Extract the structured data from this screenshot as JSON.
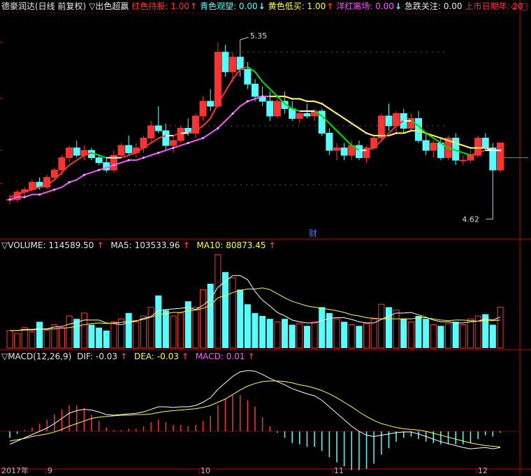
{
  "top_header": {
    "title": "德豪润达(日线 前复权)",
    "indicator": "▽出色超赢",
    "items": [
      {
        "label": "红色持股:",
        "value": "1.00",
        "arrow": "↑",
        "color": "red"
      },
      {
        "label": "青色观望:",
        "value": "0.00",
        "arrow": "↓",
        "color": "cyan"
      },
      {
        "label": "黄色低买:",
        "value": "1.00",
        "arrow": "↑",
        "color": "yellow"
      },
      {
        "label": "洋红离场:",
        "value": "0.00",
        "arrow": "↓",
        "color": "mag"
      },
      {
        "label": "急跌关注:",
        "value": "0.00",
        "arrow": "",
        "color": "white"
      },
      {
        "label": "上市日期年:",
        "value": "20",
        "arrow": "",
        "color": "red"
      }
    ],
    "corner_icons": [
      "diamond-icon",
      "window-icon"
    ]
  },
  "volume_header": {
    "label": "▽VOLUME:",
    "value": "114589.50",
    "ma5_label": "MA5:",
    "ma5_value": "103533.96",
    "ma10_label": "MA10:",
    "ma10_value": "80873.45"
  },
  "macd_header": {
    "label": "▽MACD(12,26,9)",
    "dif_label": "DIF:",
    "dif_value": "-0.03",
    "dea_label": "DEA:",
    "dea_value": "-0.03",
    "macd_label": "MACD:",
    "macd_value": "0.01"
  },
  "price_annotations": {
    "high": "5.35",
    "low": "4.62",
    "marker": "财"
  },
  "time_axis": [
    "2017年",
    "9",
    "10",
    "11",
    "12"
  ],
  "colors": {
    "up": "#ff3232",
    "down": "#54ffff",
    "yellow": "#ffff3c",
    "magenta": "#ff54ff",
    "green": "#00e000",
    "white": "#ffffff",
    "grid": "#c00000"
  },
  "chart_data": {
    "type": "candlestick",
    "price_range": [
      4.55,
      5.45
    ],
    "candles": [
      [
        4.7,
        4.72,
        4.68,
        4.7
      ],
      [
        4.7,
        4.74,
        4.69,
        4.73
      ],
      [
        4.73,
        4.75,
        4.71,
        4.74
      ],
      [
        4.74,
        4.78,
        4.73,
        4.77
      ],
      [
        4.77,
        4.79,
        4.74,
        4.75
      ],
      [
        4.75,
        4.8,
        4.74,
        4.79
      ],
      [
        4.79,
        4.83,
        4.78,
        4.82
      ],
      [
        4.82,
        4.88,
        4.8,
        4.87
      ],
      [
        4.87,
        4.92,
        4.85,
        4.91
      ],
      [
        4.91,
        4.94,
        4.87,
        4.88
      ],
      [
        4.88,
        4.92,
        4.86,
        4.9
      ],
      [
        4.9,
        4.91,
        4.86,
        4.87
      ],
      [
        4.87,
        4.88,
        4.84,
        4.85
      ],
      [
        4.85,
        4.87,
        4.81,
        4.82
      ],
      [
        4.82,
        4.9,
        4.81,
        4.88
      ],
      [
        4.88,
        4.93,
        4.87,
        4.92
      ],
      [
        4.92,
        4.96,
        4.88,
        4.89
      ],
      [
        4.89,
        4.93,
        4.87,
        4.91
      ],
      [
        4.91,
        4.96,
        4.89,
        4.95
      ],
      [
        4.95,
        5.02,
        4.93,
        5.0
      ],
      [
        5.0,
        5.08,
        4.97,
        4.98
      ],
      [
        4.98,
        5.01,
        4.9,
        4.92
      ],
      [
        4.92,
        4.96,
        4.89,
        4.94
      ],
      [
        4.94,
        5.0,
        4.93,
        4.99
      ],
      [
        4.99,
        5.03,
        4.96,
        4.97
      ],
      [
        4.97,
        5.05,
        4.95,
        5.04
      ],
      [
        5.04,
        5.12,
        5.02,
        5.1
      ],
      [
        5.1,
        5.15,
        5.06,
        5.08
      ],
      [
        5.08,
        5.34,
        5.07,
        5.3
      ],
      [
        5.3,
        5.33,
        5.2,
        5.22
      ],
      [
        5.22,
        5.3,
        5.18,
        5.28
      ],
      [
        5.28,
        5.35,
        5.2,
        5.23
      ],
      [
        5.23,
        5.26,
        5.15,
        5.17
      ],
      [
        5.17,
        5.19,
        5.1,
        5.12
      ],
      [
        5.12,
        5.16,
        5.08,
        5.1
      ],
      [
        5.1,
        5.14,
        5.02,
        5.04
      ],
      [
        5.04,
        5.12,
        5.03,
        5.1
      ],
      [
        5.1,
        5.14,
        5.05,
        5.07
      ],
      [
        5.07,
        5.1,
        5.02,
        5.03
      ],
      [
        5.03,
        5.06,
        5.01,
        5.05
      ],
      [
        5.05,
        5.09,
        5.03,
        5.04
      ],
      [
        5.04,
        5.07,
        5.02,
        5.06
      ],
      [
        5.06,
        5.07,
        4.96,
        4.97
      ],
      [
        4.97,
        4.99,
        4.88,
        4.9
      ],
      [
        4.9,
        4.93,
        4.86,
        4.91
      ],
      [
        4.91,
        4.93,
        4.86,
        4.88
      ],
      [
        4.88,
        4.94,
        4.86,
        4.92
      ],
      [
        4.92,
        4.94,
        4.86,
        4.87
      ],
      [
        4.87,
        4.92,
        4.85,
        4.91
      ],
      [
        4.91,
        4.96,
        4.9,
        4.95
      ],
      [
        4.95,
        5.05,
        4.94,
        5.04
      ],
      [
        5.04,
        5.09,
        4.98,
        5.0
      ],
      [
        5.0,
        5.06,
        4.97,
        5.05
      ],
      [
        5.05,
        5.07,
        4.97,
        4.99
      ],
      [
        4.99,
        5.05,
        4.98,
        5.03
      ],
      [
        5.03,
        5.06,
        4.93,
        4.94
      ],
      [
        4.94,
        4.97,
        4.88,
        4.9
      ],
      [
        4.9,
        4.94,
        4.87,
        4.93
      ],
      [
        4.93,
        4.95,
        4.86,
        4.87
      ],
      [
        4.87,
        4.96,
        4.86,
        4.95
      ],
      [
        4.95,
        4.97,
        4.84,
        4.86
      ],
      [
        4.86,
        4.88,
        4.84,
        4.86
      ],
      [
        4.86,
        4.9,
        4.85,
        4.88
      ],
      [
        4.88,
        4.96,
        4.87,
        4.95
      ],
      [
        4.95,
        4.97,
        4.9,
        4.91
      ],
      [
        4.91,
        4.93,
        4.62,
        4.82
      ],
      [
        4.82,
        4.93,
        4.81,
        4.93
      ]
    ],
    "ma_short": [
      4.71,
      4.72,
      4.73,
      4.74,
      4.75,
      4.76,
      4.78,
      4.81,
      4.84,
      4.86,
      4.88,
      4.89,
      4.88,
      4.87,
      4.87,
      4.87,
      4.88,
      4.89,
      4.91,
      4.93,
      4.95,
      4.96,
      4.96,
      4.97,
      4.97,
      4.98,
      5.0,
      5.03,
      5.09,
      5.14,
      5.19,
      5.23,
      5.24,
      5.22,
      5.18,
      5.15,
      5.12,
      5.09,
      5.07,
      5.06,
      5.06,
      5.06,
      5.04,
      5.01,
      4.98,
      4.95,
      4.92,
      4.9,
      4.9,
      4.91,
      4.94,
      4.97,
      5.0,
      5.02,
      5.02,
      5.0,
      4.97,
      4.95,
      4.93,
      4.91,
      4.9,
      4.89,
      4.88,
      4.89,
      4.9,
      4.9,
      4.9
    ],
    "ma_long": [
      4.7,
      4.71,
      4.71,
      4.72,
      4.72,
      4.73,
      4.74,
      4.75,
      4.77,
      4.78,
      4.8,
      4.81,
      4.82,
      4.83,
      4.84,
      4.85,
      4.86,
      4.86,
      4.87,
      4.88,
      4.89,
      4.9,
      4.91,
      4.92,
      4.93,
      4.94,
      4.95,
      4.97,
      4.99,
      5.02,
      5.05,
      5.08,
      5.1,
      5.11,
      5.12,
      5.12,
      5.12,
      5.12,
      5.11,
      5.11,
      5.1,
      5.1,
      5.09,
      5.07,
      5.05,
      5.03,
      5.01,
      4.99,
      4.97,
      4.96,
      4.96,
      4.96,
      4.97,
      4.97,
      4.98,
      4.98,
      4.97,
      4.96,
      4.95,
      4.94,
      4.93,
      4.92,
      4.91,
      4.91,
      4.91,
      4.9,
      4.9
    ],
    "volume": [
      30,
      25,
      35,
      28,
      45,
      30,
      40,
      35,
      55,
      50,
      60,
      40,
      35,
      30,
      45,
      50,
      60,
      45,
      55,
      70,
      90,
      65,
      55,
      60,
      80,
      70,
      100,
      110,
      160,
      130,
      120,
      100,
      75,
      60,
      55,
      50,
      45,
      50,
      40,
      42,
      38,
      45,
      70,
      60,
      50,
      45,
      40,
      38,
      42,
      50,
      75,
      70,
      65,
      50,
      45,
      55,
      50,
      40,
      38,
      42,
      45,
      40,
      50,
      55,
      58,
      40,
      70
    ],
    "volume_up": [
      true,
      true,
      true,
      true,
      false,
      true,
      true,
      true,
      true,
      false,
      true,
      false,
      false,
      false,
      true,
      true,
      false,
      true,
      true,
      true,
      false,
      false,
      true,
      true,
      false,
      true,
      true,
      false,
      true,
      false,
      true,
      false,
      false,
      false,
      false,
      false,
      true,
      false,
      false,
      true,
      false,
      true,
      false,
      false,
      true,
      false,
      true,
      false,
      true,
      true,
      true,
      false,
      true,
      false,
      true,
      false,
      false,
      true,
      false,
      true,
      false,
      true,
      true,
      true,
      false,
      false,
      true
    ],
    "vol_ma5": [
      30,
      30,
      32,
      32,
      33,
      33,
      36,
      37,
      41,
      44,
      48,
      48,
      48,
      43,
      42,
      40,
      44,
      46,
      51,
      54,
      64,
      66,
      67,
      68,
      70,
      66,
      73,
      84,
      104,
      114,
      124,
      124,
      117,
      97,
      82,
      72,
      61,
      55,
      48,
      45,
      43,
      43,
      47,
      51,
      52,
      52,
      49,
      45,
      43,
      43,
      49,
      55,
      60,
      60,
      61,
      57,
      53,
      48,
      45,
      45,
      43,
      43,
      45,
      46,
      50,
      48,
      53
    ],
    "vol_ma10": [
      30,
      30,
      31,
      31,
      32,
      32,
      33,
      34,
      35,
      37,
      40,
      42,
      43,
      42,
      43,
      44,
      46,
      47,
      49,
      53,
      57,
      59,
      61,
      61,
      64,
      65,
      68,
      73,
      86,
      90,
      95,
      99,
      101,
      101,
      103,
      100,
      93,
      86,
      80,
      76,
      72,
      70,
      68,
      66,
      64,
      61,
      57,
      55,
      52,
      51,
      50,
      50,
      50,
      50,
      50,
      52,
      52,
      50,
      48,
      47,
      48,
      48,
      47,
      46,
      47,
      47,
      48
    ],
    "dif": [
      -0.02,
      -0.015,
      -0.01,
      -0.005,
      0.0,
      0.005,
      0.012,
      0.02,
      0.028,
      0.032,
      0.034,
      0.033,
      0.03,
      0.026,
      0.025,
      0.026,
      0.027,
      0.028,
      0.03,
      0.034,
      0.038,
      0.038,
      0.037,
      0.038,
      0.038,
      0.04,
      0.045,
      0.052,
      0.065,
      0.075,
      0.085,
      0.092,
      0.094,
      0.093,
      0.088,
      0.082,
      0.077,
      0.072,
      0.066,
      0.062,
      0.058,
      0.055,
      0.048,
      0.038,
      0.028,
      0.018,
      0.008,
      0.0,
      -0.006,
      -0.008,
      -0.006,
      -0.004,
      -0.002,
      -0.001,
      -0.001,
      -0.004,
      -0.008,
      -0.012,
      -0.016,
      -0.019,
      -0.022,
      -0.025,
      -0.027,
      -0.026,
      -0.025,
      -0.027,
      -0.025
    ],
    "dea": [
      -0.015,
      -0.013,
      -0.011,
      -0.008,
      -0.006,
      -0.004,
      -0.001,
      0.003,
      0.008,
      0.012,
      0.016,
      0.02,
      0.022,
      0.023,
      0.024,
      0.025,
      0.025,
      0.026,
      0.026,
      0.027,
      0.029,
      0.031,
      0.032,
      0.033,
      0.034,
      0.035,
      0.037,
      0.04,
      0.045,
      0.05,
      0.057,
      0.064,
      0.07,
      0.074,
      0.077,
      0.078,
      0.078,
      0.077,
      0.075,
      0.072,
      0.07,
      0.067,
      0.063,
      0.058,
      0.052,
      0.045,
      0.038,
      0.03,
      0.023,
      0.017,
      0.012,
      0.009,
      0.006,
      0.004,
      0.003,
      0.002,
      0.0,
      -0.003,
      -0.006,
      -0.009,
      -0.012,
      -0.015,
      -0.018,
      -0.02,
      -0.022,
      -0.023,
      -0.024
    ],
    "macd_range": [
      -0.055,
      0.105
    ]
  }
}
